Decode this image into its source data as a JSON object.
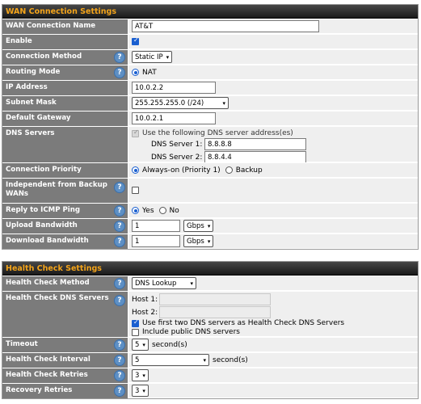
{
  "wan": {
    "header": "WAN Connection Settings",
    "name_label": "WAN Connection Name",
    "name_value": "AT&T",
    "enable_label": "Enable",
    "method_label": "Connection Method",
    "method_value": "Static IP",
    "routing_label": "Routing Mode",
    "routing_value": "NAT",
    "ip_label": "IP Address",
    "ip_value": "10.0.2.2",
    "mask_label": "Subnet Mask",
    "mask_value": "255.255.255.0 (/24)",
    "gw_label": "Default Gateway",
    "gw_value": "10.0.2.1",
    "dns_label": "DNS Servers",
    "dns_use_text": "Use the following DNS server address(es)",
    "dns1_label": "DNS Server 1:",
    "dns1_value": "8.8.8.8",
    "dns2_label": "DNS Server 2:",
    "dns2_value": "8.8.4.4",
    "priority_label": "Connection Priority",
    "priority_opt1": "Always-on (Priority 1)",
    "priority_opt2": "Backup",
    "indep_label": "Independent from Backup WANs",
    "icmp_label": "Reply to ICMP Ping",
    "icmp_yes": "Yes",
    "icmp_no": "No",
    "upload_label": "Upload Bandwidth",
    "upload_value": "1",
    "upload_unit": "Gbps",
    "download_label": "Download Bandwidth",
    "download_value": "1",
    "download_unit": "Gbps"
  },
  "health": {
    "header": "Health Check Settings",
    "method_label": "Health Check Method",
    "method_value": "DNS Lookup",
    "dns_label": "Health Check DNS Servers",
    "host1_label": "Host 1:",
    "host2_label": "Host 2:",
    "use_first_text": "Use first two DNS servers as Health Check DNS Servers",
    "include_public_text": "Include public DNS servers",
    "timeout_label": "Timeout",
    "timeout_value": "5",
    "timeout_unit": "second(s)",
    "interval_label": "Health Check Interval",
    "interval_value": "5",
    "interval_unit": "second(s)",
    "retries_label": "Health Check Retries",
    "retries_value": "3",
    "recovery_label": "Recovery Retries",
    "recovery_value": "3"
  },
  "icons": {
    "help": "?",
    "dropdown": "▾"
  },
  "colors": {
    "header_text": "#f4a41a",
    "label_bg": "#7b7b7b",
    "value_bg": "#efefef",
    "accent": "#1a5fd0"
  }
}
